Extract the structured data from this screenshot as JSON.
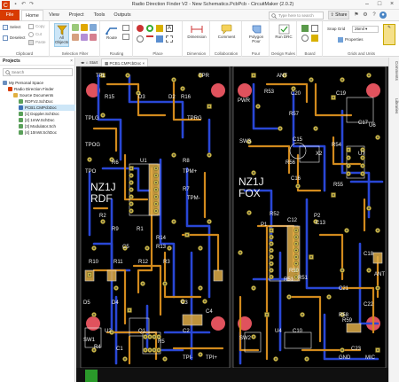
{
  "window": {
    "title": "Radio Direction Finder V2 - New Schematics.PcbPcb - CircuitMaker (2.0.2)"
  },
  "ribbon_tabs": {
    "file": "File",
    "home": "Home",
    "view": "View",
    "project": "Project",
    "tools": "Tools",
    "outputs": "Outputs"
  },
  "search": {
    "placeholder": "Type here to search"
  },
  "share_label": "Share",
  "ribbon": {
    "clipboard": {
      "label": "Clipboard",
      "select": "Select",
      "deselect": "Deselect",
      "copy": "Copy",
      "cut": "Cut",
      "paste": "Paste"
    },
    "selection_filter": {
      "label": "Selection Filter",
      "all_objects": "All Objects"
    },
    "routing": {
      "label": "Routing",
      "route": "Route"
    },
    "place": {
      "label": "Place"
    },
    "dimension": {
      "label": "Dimension",
      "dimension": "Dimension"
    },
    "collaboration": {
      "label": "Collaboration",
      "comment": "Comment"
    },
    "pour": {
      "label": "Pour",
      "polygon_pour": "Polygon Pour"
    },
    "design_rules": {
      "label": "Design Rules",
      "run_drc": "Run DRC"
    },
    "board": {
      "label": "Board"
    },
    "grids": {
      "label": "Grids and Units",
      "snap_grid": "Snap Grid",
      "grid_value": "25mil",
      "properties": "Properties"
    }
  },
  "projects_panel": {
    "title": "Projects",
    "search_placeholder": "Search",
    "tree": [
      {
        "label": "My Personal Space",
        "level": 0,
        "selected": false,
        "icon": "workspace-icon"
      },
      {
        "label": "Radio Direction Finder",
        "level": 1,
        "selected": false,
        "icon": "project-icon"
      },
      {
        "label": "Source Documents",
        "level": 2,
        "selected": false,
        "icon": "folder-icon"
      },
      {
        "label": "RDFV2.SchDoc",
        "level": 3,
        "selected": false,
        "icon": "schematic-icon"
      },
      {
        "label": "PCB1.CMPcbDoc",
        "level": 3,
        "selected": true,
        "icon": "pcb-icon"
      },
      {
        "label": "[1] Doppler.SchDoc",
        "level": 3,
        "selected": false,
        "icon": "schematic-icon"
      },
      {
        "label": "[2] 1mW.SchDoc",
        "level": 3,
        "selected": false,
        "icon": "schematic-icon"
      },
      {
        "label": "[3] Modulator.Sch",
        "level": 3,
        "selected": false,
        "icon": "schematic-icon"
      },
      {
        "label": "[4] 10mW.SchDoc",
        "level": 3,
        "selected": false,
        "icon": "schematic-icon"
      }
    ]
  },
  "side_tabs": {
    "comments": "Comments",
    "libraries": "Libraries"
  },
  "doc_tabs": {
    "start": "Start",
    "pcb": "PCB1.CMPcbDoc"
  },
  "pcb": {
    "left_board": {
      "title_line1": "NZ1J",
      "title_line2": "RDF",
      "labels": [
        "TPL",
        "TPR",
        "R15",
        "D3",
        "D2",
        "R16",
        "TPLG",
        "TPRG",
        "TPOG",
        "TPO",
        "R6",
        "U1",
        "R8",
        "TPM+",
        "R7",
        "TPM-",
        "R2",
        "R1",
        "R9",
        "R14",
        "R13",
        "C5",
        "R10",
        "R11",
        "R12",
        "R3",
        "D5",
        "D4",
        "C3",
        "C4",
        "SW1",
        "U2",
        "C1",
        "R4",
        "R5",
        "C2",
        "Q1",
        "TPI-",
        "TPI+"
      ]
    },
    "right_board": {
      "title_line1": "NZ1J",
      "title_line2": "FOX",
      "labels": [
        "ANT",
        "PWR",
        "R53",
        "C20",
        "C19",
        "R57",
        "C17",
        "U6",
        "SW3",
        "C15",
        "X2",
        "R56",
        "R54",
        "C16",
        "R55",
        "U7",
        "R52",
        "C12",
        "C13",
        "P2",
        "P1",
        "R50",
        "R51",
        "C18",
        "ANT",
        "C21",
        "R58",
        "C22",
        "U4",
        "C10",
        "SW2",
        "R59",
        "C23",
        "GND",
        "MIC",
        "R51"
      ]
    }
  }
}
